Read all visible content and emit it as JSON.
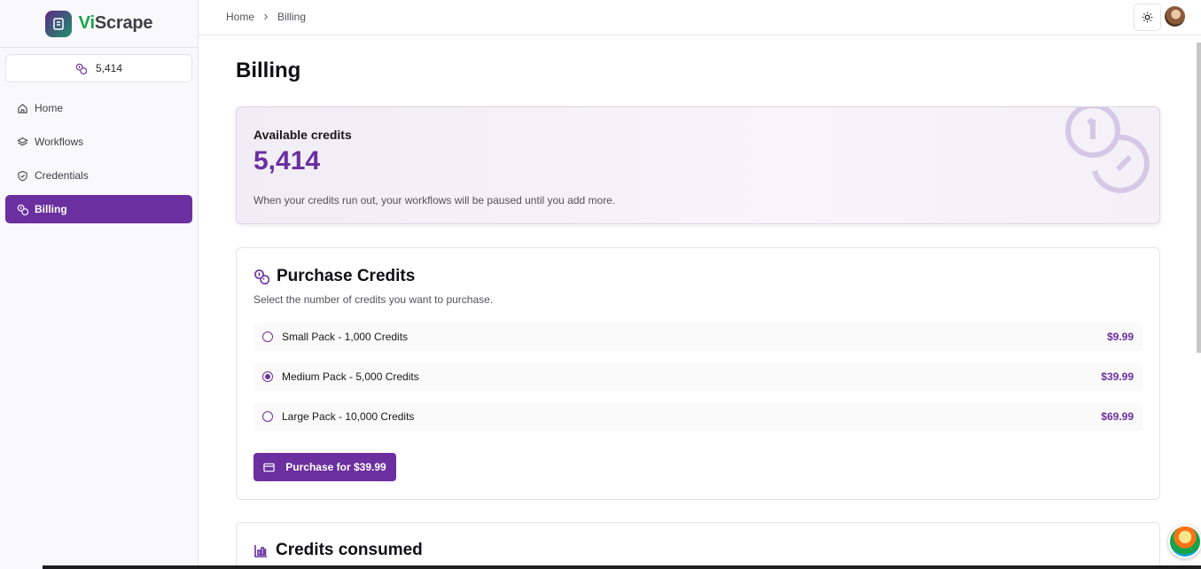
{
  "brand": {
    "vi": "Vi",
    "rest": "Scrape",
    "logo_icon": "notebook-icon"
  },
  "sidebar": {
    "credits": "5,414",
    "credits_icon": "coins-icon",
    "items": [
      {
        "label": "Home",
        "icon": "home-icon",
        "active": false
      },
      {
        "label": "Workflows",
        "icon": "layers-icon",
        "active": false
      },
      {
        "label": "Credentials",
        "icon": "shield-check-icon",
        "active": false
      },
      {
        "label": "Billing",
        "icon": "coins-icon",
        "active": true
      }
    ]
  },
  "header": {
    "breadcrumb": [
      "Home",
      "Billing"
    ],
    "theme_icon": "sun-icon"
  },
  "main": {
    "title": "Billing",
    "available": {
      "label": "Available credits",
      "value": "5,414",
      "note": "When your credits run out, your workflows will be paused until you add more."
    },
    "purchase": {
      "title": "Purchase Credits",
      "subtitle": "Select the number of credits you want to purchase.",
      "packs": [
        {
          "label": "Small Pack - 1,000 Credits",
          "price": "$9.99",
          "selected": false
        },
        {
          "label": "Medium Pack - 5,000 Credits",
          "price": "$39.99",
          "selected": true
        },
        {
          "label": "Large Pack - 10,000 Credits",
          "price": "$69.99",
          "selected": false
        }
      ],
      "button": "Purchase for $39.99"
    },
    "consumed": {
      "title": "Credits consumed"
    }
  },
  "colors": {
    "accent": "#6b2fa0",
    "brand_green": "#16a34a"
  }
}
